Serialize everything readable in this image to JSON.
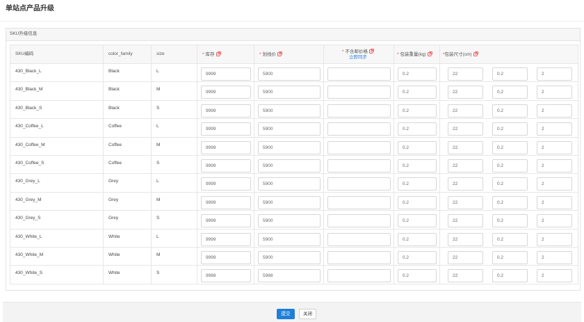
{
  "page": {
    "title": "单站点产品升级"
  },
  "panel": {
    "title": "SKU升级信息"
  },
  "table": {
    "required_mark": "*",
    "headers": {
      "sku": "SKU编码",
      "color_family": "color_family",
      "size": "size",
      "stock": "库存",
      "listing_price": "划线价",
      "price_excl_shipping": "不含邮价格",
      "sync_link": "立即同步",
      "package_weight": "包装重量(kg)",
      "package_size": "包装尺寸(cm)"
    },
    "rows": [
      {
        "sku": "430_Black_L",
        "color_family": "Black",
        "size": "L",
        "stock": "9999",
        "listing_price": "5900",
        "price_excl_shipping": "",
        "package_weight": "0.2",
        "package_dims": [
          "22",
          "0.2",
          "2"
        ]
      },
      {
        "sku": "430_Black_M",
        "color_family": "Black",
        "size": "M",
        "stock": "9999",
        "listing_price": "5900",
        "price_excl_shipping": "",
        "package_weight": "0.2",
        "package_dims": [
          "22",
          "0.2",
          "2"
        ]
      },
      {
        "sku": "430_Black_S",
        "color_family": "Black",
        "size": "S",
        "stock": "9999",
        "listing_price": "5900",
        "price_excl_shipping": "",
        "package_weight": "0.2",
        "package_dims": [
          "22",
          "0.2",
          "2"
        ]
      },
      {
        "sku": "430_Coffee_L",
        "color_family": "Coffee",
        "size": "L",
        "stock": "9999",
        "listing_price": "5900",
        "price_excl_shipping": "",
        "package_weight": "0.2",
        "package_dims": [
          "22",
          "0.2",
          "2"
        ]
      },
      {
        "sku": "430_Coffee_M",
        "color_family": "Coffee",
        "size": "M",
        "stock": "9999",
        "listing_price": "5900",
        "price_excl_shipping": "",
        "package_weight": "0.2",
        "package_dims": [
          "22",
          "0.2",
          "2"
        ]
      },
      {
        "sku": "430_Coffee_S",
        "color_family": "Coffee",
        "size": "S",
        "stock": "9999",
        "listing_price": "5900",
        "price_excl_shipping": "",
        "package_weight": "0.2",
        "package_dims": [
          "22",
          "0.2",
          "2"
        ]
      },
      {
        "sku": "430_Grey_L",
        "color_family": "Grey",
        "size": "L",
        "stock": "9999",
        "listing_price": "5900",
        "price_excl_shipping": "",
        "package_weight": "0.2",
        "package_dims": [
          "22",
          "0.2",
          "2"
        ]
      },
      {
        "sku": "430_Grey_M",
        "color_family": "Grey",
        "size": "M",
        "stock": "9999",
        "listing_price": "5900",
        "price_excl_shipping": "",
        "package_weight": "0.2",
        "package_dims": [
          "22",
          "0.2",
          "2"
        ]
      },
      {
        "sku": "430_Grey_S",
        "color_family": "Grey",
        "size": "S",
        "stock": "9999",
        "listing_price": "5900",
        "price_excl_shipping": "",
        "package_weight": "0.2",
        "package_dims": [
          "22",
          "0.2",
          "2"
        ]
      },
      {
        "sku": "430_White_L",
        "color_family": "White",
        "size": "L",
        "stock": "9999",
        "listing_price": "5900",
        "price_excl_shipping": "",
        "package_weight": "0.2",
        "package_dims": [
          "22",
          "0.2",
          "2"
        ]
      },
      {
        "sku": "430_White_M",
        "color_family": "White",
        "size": "M",
        "stock": "9999",
        "listing_price": "5900",
        "price_excl_shipping": "",
        "package_weight": "0.2",
        "package_dims": [
          "22",
          "0.2",
          "2"
        ]
      },
      {
        "sku": "430_White_S",
        "color_family": "White",
        "size": "S",
        "stock": "9988",
        "listing_price": "5988",
        "price_excl_shipping": "",
        "package_weight": "0.2",
        "package_dims": [
          "22",
          "0.2",
          "2"
        ]
      }
    ]
  },
  "footer": {
    "submit_label": "提交",
    "close_label": "关闭"
  },
  "icons": {
    "batch_edit": "batch-edit-icon"
  },
  "colors": {
    "accent": "#1f7fd8",
    "required": "#e4393c",
    "edit_icon": "#e4393c",
    "link": "#2f80d8"
  }
}
